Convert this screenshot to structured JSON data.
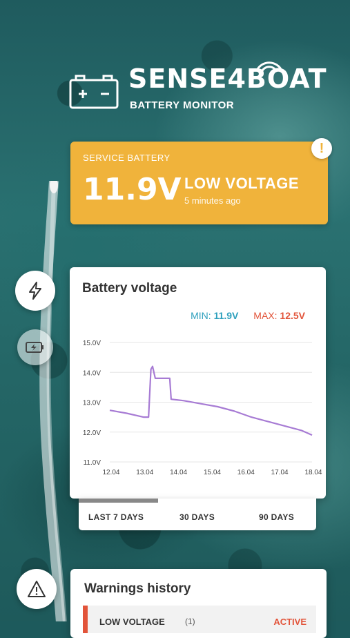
{
  "brand": {
    "name": "SENSE4BOAT",
    "subtitle": "BATTERY MONITOR"
  },
  "alert": {
    "category": "SERVICE BATTERY",
    "voltage": "11.9V",
    "status": "LOW VOLTAGE",
    "time_ago": "5 minutes ago",
    "badge": "!",
    "color": "#f0b33b"
  },
  "side_buttons": [
    {
      "icon": "lightning-icon"
    },
    {
      "icon": "battery-charging-icon"
    }
  ],
  "voltage_chart": {
    "title": "Battery voltage",
    "min_label": "MIN:",
    "min_value": "11.9V",
    "max_label": "MAX:",
    "max_value": "12.5V",
    "min_color": "#2ea0bd",
    "max_color": "#e2543a",
    "line_color": "#a77bd4"
  },
  "chart_data": {
    "type": "line",
    "title": "Battery voltage",
    "xlabel": "",
    "ylabel": "",
    "x_ticks": [
      "12.04",
      "13.04",
      "14.04",
      "15.04",
      "16.04",
      "17.04",
      "18.04"
    ],
    "y_ticks": [
      "11.0V",
      "12.0V",
      "13.0V",
      "14.0V",
      "15.0V"
    ],
    "ylim": [
      11.0,
      15.0
    ],
    "xlim": [
      12.0,
      18.0
    ],
    "grid": true,
    "series": [
      {
        "points": [
          [
            12.0,
            12.73
          ],
          [
            12.5,
            12.63
          ],
          [
            13.0,
            12.5
          ],
          [
            13.15,
            12.5
          ],
          [
            13.22,
            14.1
          ],
          [
            13.27,
            14.2
          ],
          [
            13.35,
            13.8
          ],
          [
            13.55,
            13.8
          ],
          [
            13.78,
            13.8
          ],
          [
            13.82,
            13.1
          ],
          [
            14.2,
            13.05
          ],
          [
            14.7,
            12.95
          ],
          [
            15.2,
            12.85
          ],
          [
            15.7,
            12.7
          ],
          [
            16.2,
            12.5
          ],
          [
            16.7,
            12.35
          ],
          [
            17.2,
            12.2
          ],
          [
            17.7,
            12.05
          ],
          [
            18.0,
            11.9
          ]
        ]
      }
    ]
  },
  "range": {
    "tabs": [
      "LAST 7 DAYS",
      "30 DAYS",
      "90 DAYS"
    ],
    "selected": 0
  },
  "warnings": {
    "title": "Warnings history",
    "icon": "warning-icon",
    "items": [
      {
        "name": "LOW VOLTAGE",
        "count": "(1)",
        "status": "ACTIVE"
      }
    ]
  }
}
